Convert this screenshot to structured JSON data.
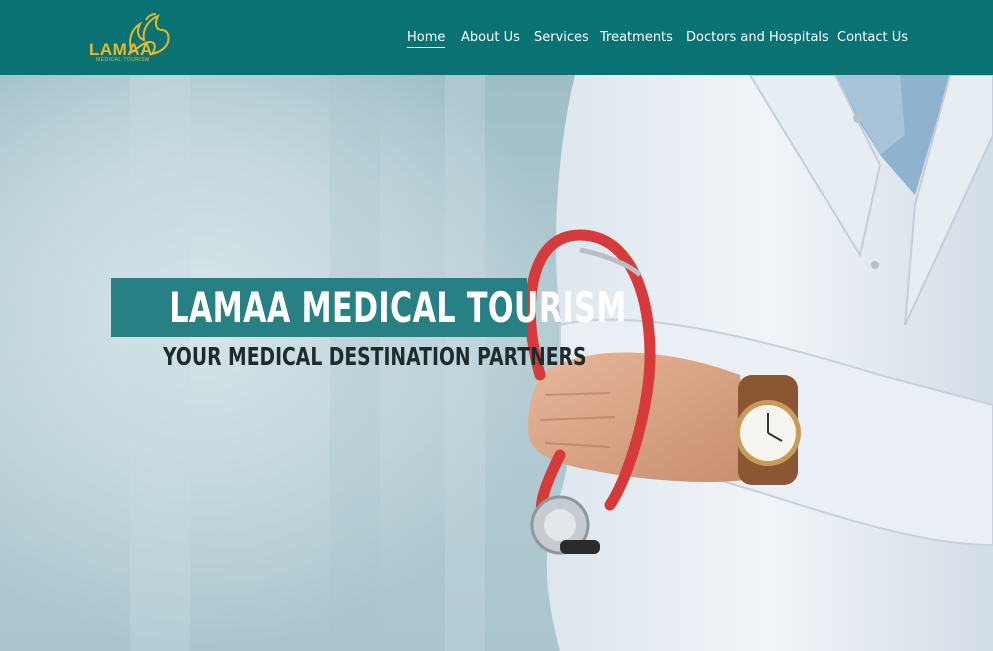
{
  "brand": {
    "logo_text": "LAMAA",
    "logo_subtext": "MEDICAL TOURISM"
  },
  "nav": {
    "items": [
      {
        "label": "Home",
        "active": true
      },
      {
        "label": "About Us",
        "active": false
      },
      {
        "label": "Services",
        "active": false
      },
      {
        "label": "Treatments",
        "active": false
      },
      {
        "label": "Doctors and Hospitals",
        "active": false
      },
      {
        "label": "Contact Us",
        "active": false
      }
    ]
  },
  "hero": {
    "title": "LAMAA MEDICAL TOURISM",
    "subtitle": "YOUR MEDICAL DESTINATION PARTNERS"
  },
  "colors": {
    "header_bg": "#0b7273",
    "title_box": "#278083",
    "logo_gold": "#e7b92e"
  }
}
